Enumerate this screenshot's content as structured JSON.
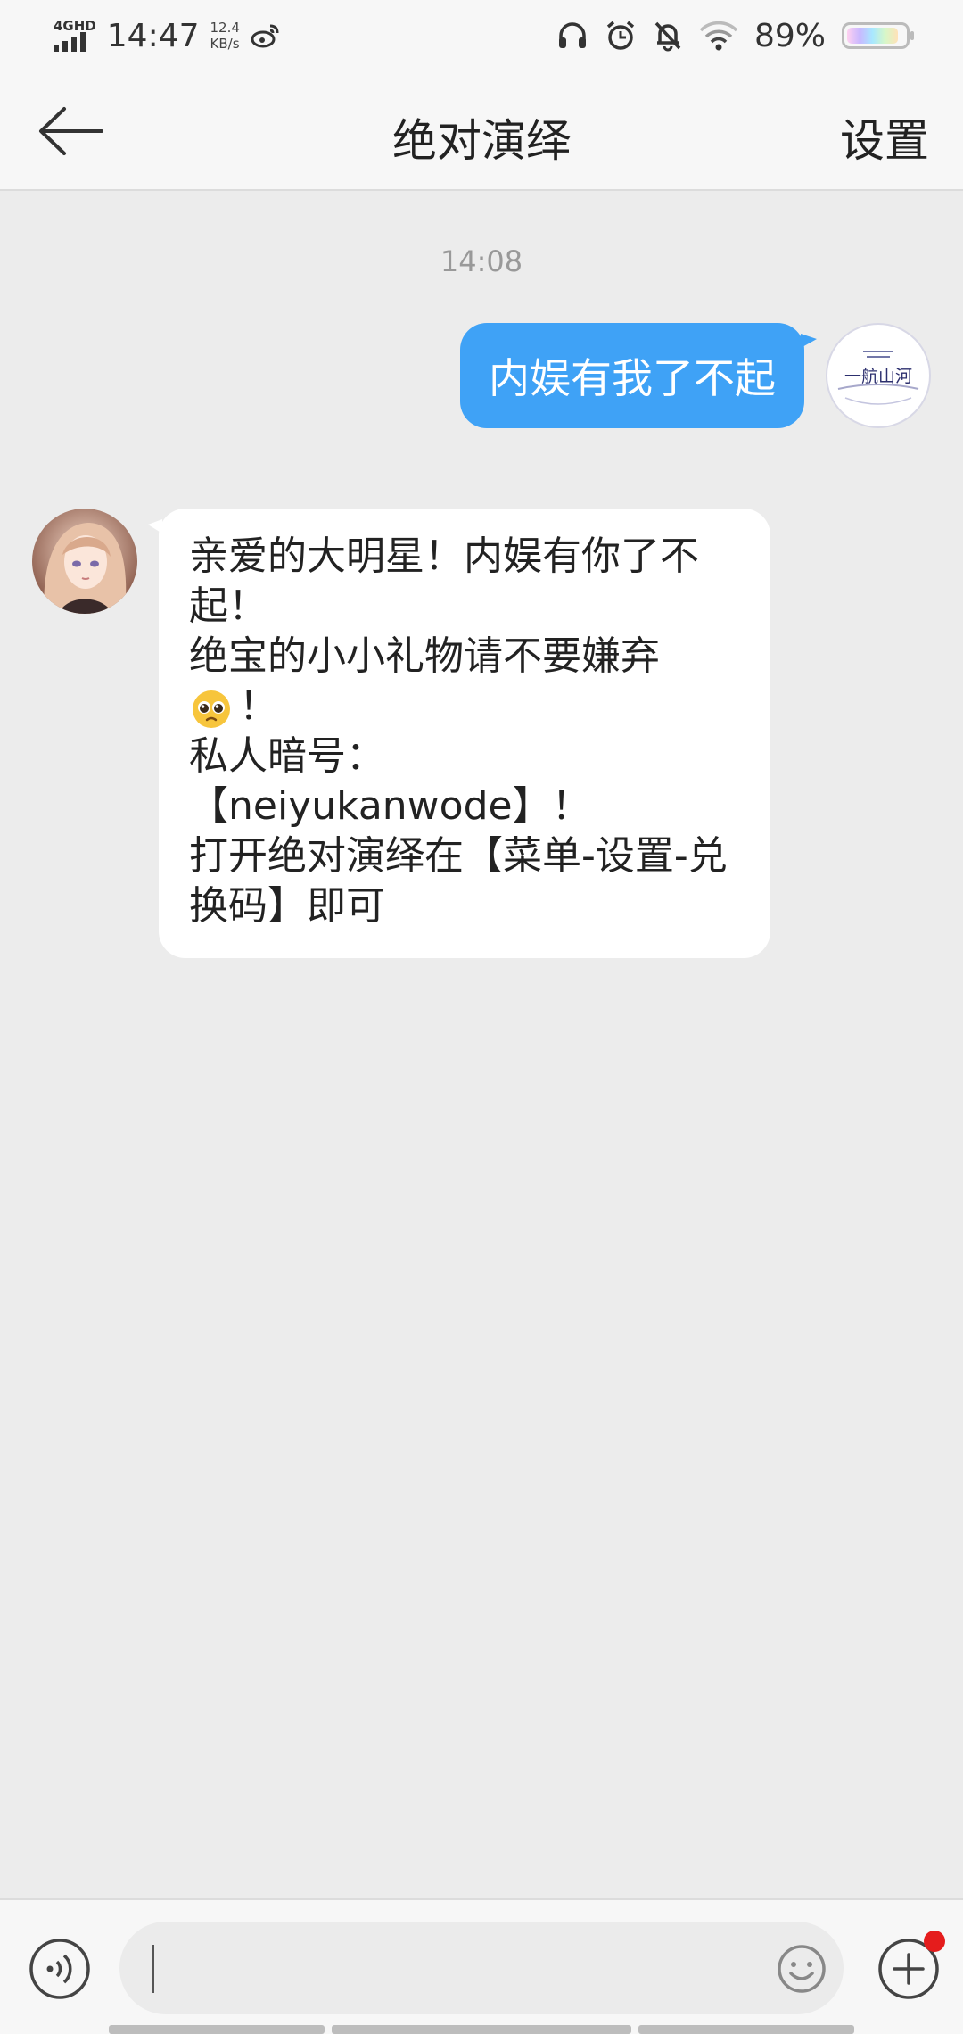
{
  "status_bar": {
    "network": "4GHD",
    "time": "14:47",
    "speed_value": "12.4",
    "speed_unit": "KB/s",
    "battery_percent": "89%",
    "battery_level": 0.89
  },
  "nav": {
    "title": "绝对演绎",
    "action_label": "设置"
  },
  "chat": {
    "timestamp": "14:08",
    "outgoing_message": "内娱有我了不起",
    "incoming_message": {
      "line1": "亲爱的大明星！内娱有你了不起！",
      "line2": "绝宝的小小礼物请不要嫌弃",
      "line3_suffix": "！",
      "line4": "私人暗号：",
      "line5": "【neiyukanwode】！",
      "line6": "打开绝对演绎在【菜单-设置-兑换码】即可"
    },
    "my_avatar_text": "一航山河"
  },
  "input_bar": {
    "value": ""
  },
  "icons": {
    "back": "arrow-left-icon",
    "voice": "voice-icon",
    "emoji": "emoji-smile-icon",
    "plus": "plus-icon"
  },
  "colors": {
    "outgoing_bubble": "#3fa2f6",
    "incoming_bubble": "#ffffff",
    "background": "#ececec",
    "badge": "#e51c1c"
  }
}
